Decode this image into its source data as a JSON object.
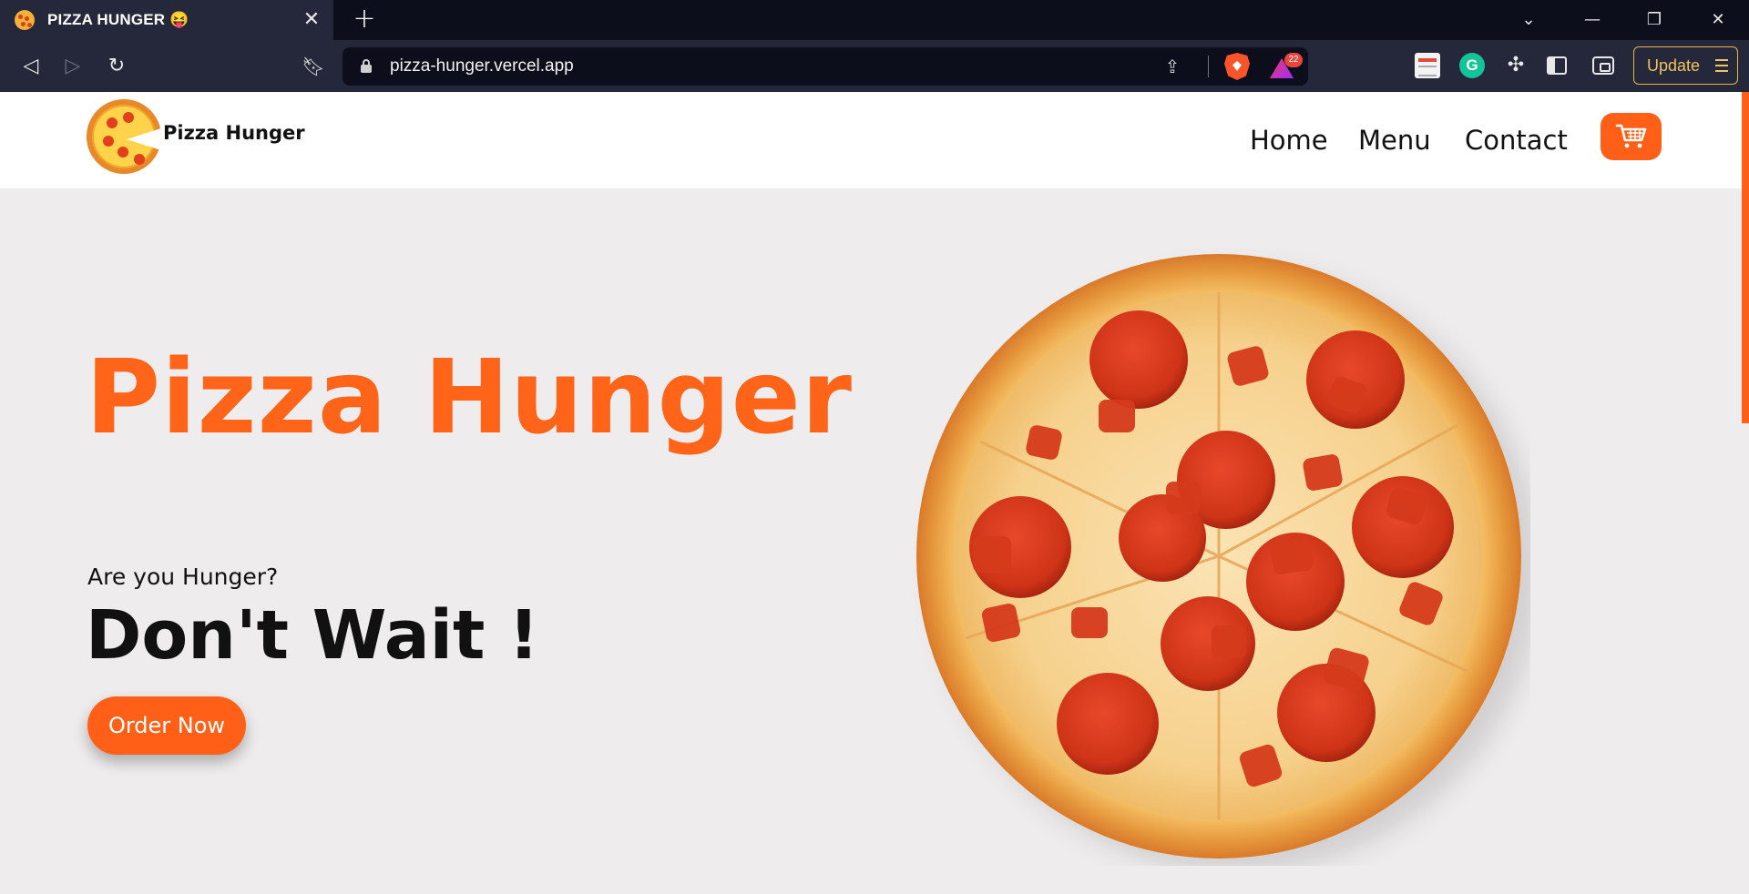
{
  "browser": {
    "tab_title": "PIZZA HUNGER 😝",
    "close_tab": "✕",
    "new_tab": "+",
    "url": "pizza-hunger.vercel.app",
    "rewards_count": "22",
    "update_label": "Update",
    "grammarly_letter": "G"
  },
  "navbar": {
    "brand": "Pizza Hunger",
    "links": [
      "Home",
      "Menu",
      "Contact"
    ]
  },
  "hero": {
    "title": "Pizza Hunger",
    "question": "Are you Hunger?",
    "slogan": "Don't Wait !",
    "cta": "Order Now"
  },
  "colors": {
    "accent": "#ff5f16",
    "page_bg": "#eeecec",
    "chrome_bg": "#25283a"
  }
}
